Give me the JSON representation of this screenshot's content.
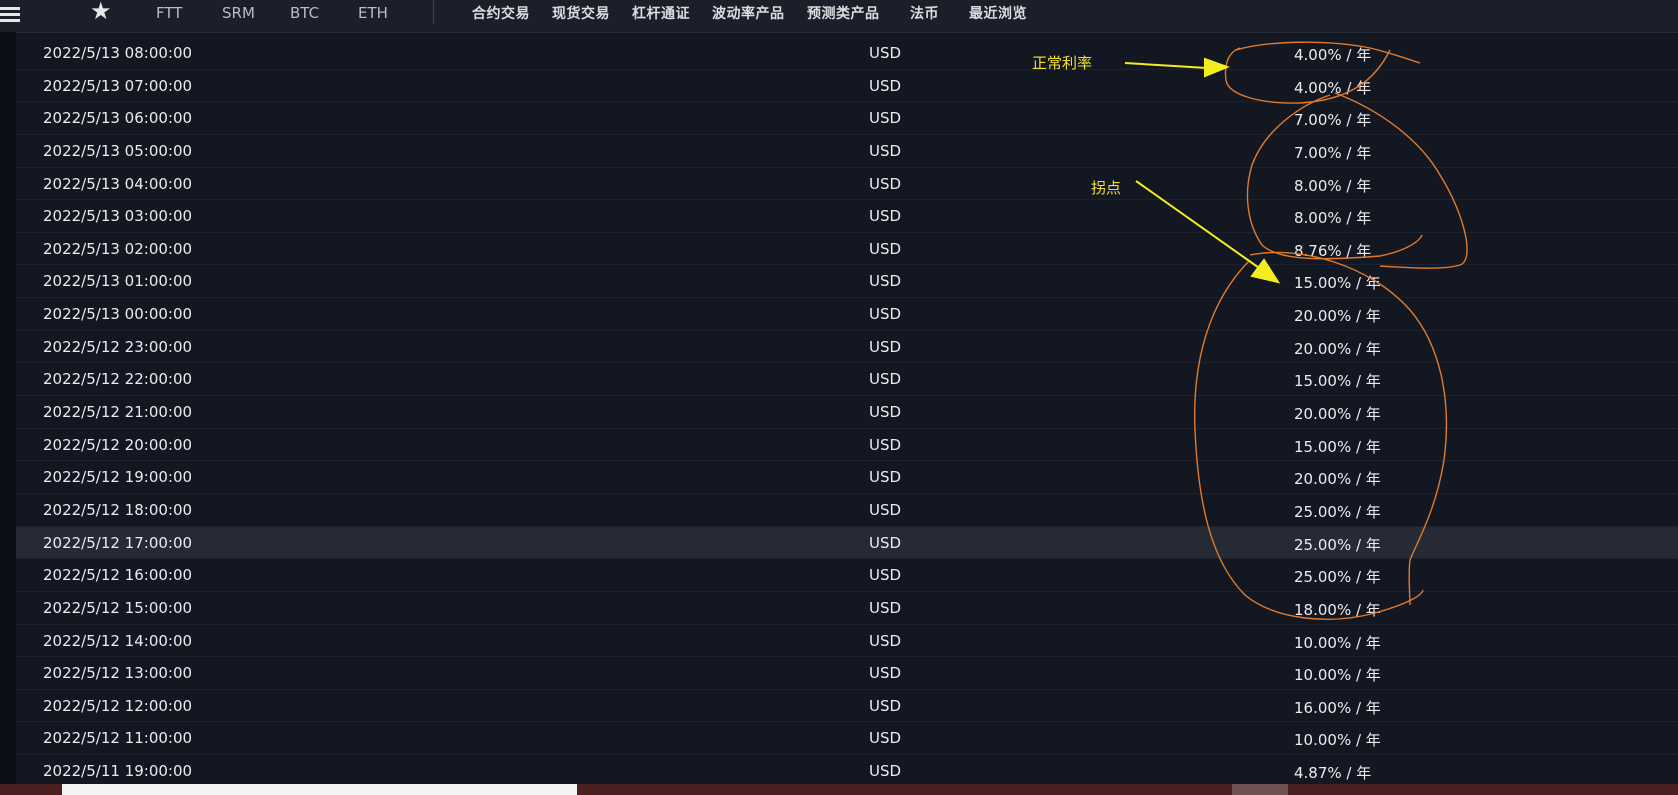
{
  "nav": {
    "coins": [
      "FTT",
      "SRM",
      "BTC",
      "ETH"
    ],
    "items": [
      "合约交易",
      "现货交易",
      "杠杆通证",
      "波动率产品",
      "预测类产品",
      "法币",
      "最近浏览"
    ]
  },
  "annotations": {
    "normal_rate": "正常利率",
    "inflection": "拐点"
  },
  "rows": [
    {
      "time": "2022/5/13 08:00:00",
      "currency": "USD",
      "rate": "4.00% / 年"
    },
    {
      "time": "2022/5/13 07:00:00",
      "currency": "USD",
      "rate": "4.00% / 年"
    },
    {
      "time": "2022/5/13 06:00:00",
      "currency": "USD",
      "rate": "7.00% / 年"
    },
    {
      "time": "2022/5/13 05:00:00",
      "currency": "USD",
      "rate": "7.00% / 年"
    },
    {
      "time": "2022/5/13 04:00:00",
      "currency": "USD",
      "rate": "8.00% / 年"
    },
    {
      "time": "2022/5/13 03:00:00",
      "currency": "USD",
      "rate": "8.00% / 年"
    },
    {
      "time": "2022/5/13 02:00:00",
      "currency": "USD",
      "rate": "8.76% / 年"
    },
    {
      "time": "2022/5/13 01:00:00",
      "currency": "USD",
      "rate": "15.00% / 年"
    },
    {
      "time": "2022/5/13 00:00:00",
      "currency": "USD",
      "rate": "20.00% / 年"
    },
    {
      "time": "2022/5/12 23:00:00",
      "currency": "USD",
      "rate": "20.00% / 年"
    },
    {
      "time": "2022/5/12 22:00:00",
      "currency": "USD",
      "rate": "15.00% / 年"
    },
    {
      "time": "2022/5/12 21:00:00",
      "currency": "USD",
      "rate": "20.00% / 年"
    },
    {
      "time": "2022/5/12 20:00:00",
      "currency": "USD",
      "rate": "15.00% / 年"
    },
    {
      "time": "2022/5/12 19:00:00",
      "currency": "USD",
      "rate": "20.00% / 年"
    },
    {
      "time": "2022/5/12 18:00:00",
      "currency": "USD",
      "rate": "25.00% / 年"
    },
    {
      "time": "2022/5/12 17:00:00",
      "currency": "USD",
      "rate": "25.00% / 年"
    },
    {
      "time": "2022/5/12 16:00:00",
      "currency": "USD",
      "rate": "25.00% / 年"
    },
    {
      "time": "2022/5/12 15:00:00",
      "currency": "USD",
      "rate": "18.00% / 年"
    },
    {
      "time": "2022/5/12 14:00:00",
      "currency": "USD",
      "rate": "10.00% / 年"
    },
    {
      "time": "2022/5/12 13:00:00",
      "currency": "USD",
      "rate": "10.00% / 年"
    },
    {
      "time": "2022/5/12 12:00:00",
      "currency": "USD",
      "rate": "16.00% / 年"
    },
    {
      "time": "2022/5/12 11:00:00",
      "currency": "USD",
      "rate": "10.00% / 年"
    },
    {
      "time": "2022/5/11 19:00:00",
      "currency": "USD",
      "rate": "4.87% / 年"
    }
  ],
  "colors": {
    "annotation_text": "#f2e22c",
    "annotation_arrow": "#f5ee1e",
    "annotation_circle": "#e07a2c",
    "row_highlight": "#262a35"
  }
}
